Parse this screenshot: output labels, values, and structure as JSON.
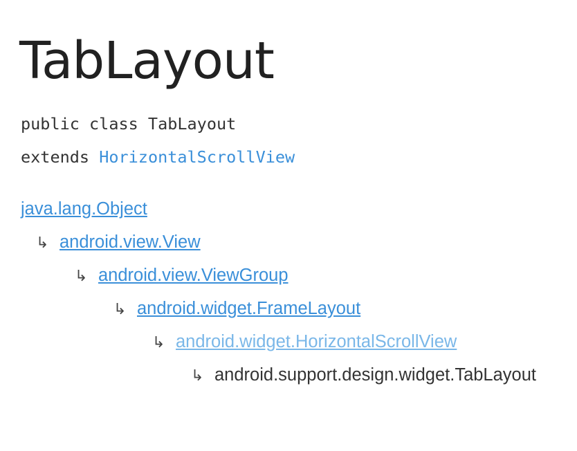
{
  "title": "TabLayout",
  "signature": {
    "declaration": "public class TabLayout",
    "extends_keyword": "extends",
    "extends_class": "HorizontalScrollView"
  },
  "hierarchy": [
    {
      "label": "java.lang.Object",
      "style": "link"
    },
    {
      "arrow": "↳",
      "label": "android.view.View",
      "style": "link"
    },
    {
      "arrow": "↳",
      "label": "android.view.ViewGroup",
      "style": "link"
    },
    {
      "arrow": "↳",
      "label": "android.widget.FrameLayout",
      "style": "link"
    },
    {
      "arrow": "↳",
      "label": "android.widget.HorizontalScrollView",
      "style": "link-light"
    },
    {
      "arrow": "↳",
      "label": "android.support.design.widget.TabLayout",
      "style": "current"
    }
  ],
  "colors": {
    "link": "#3a8fd9",
    "link_light": "#7ab7e8",
    "text": "#333333",
    "title": "#212121"
  }
}
